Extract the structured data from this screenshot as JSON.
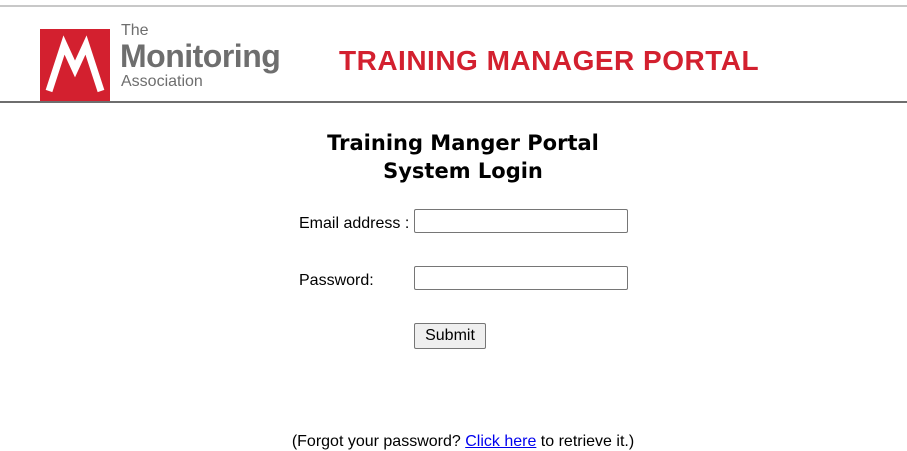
{
  "header": {
    "logo": {
      "line1": "The",
      "line2": "Monitoring",
      "line3": "Association"
    },
    "portal_title": "TRAINING MANAGER PORTAL",
    "brand_color": "#d3202f"
  },
  "login": {
    "heading_line1": "Training Manger Portal",
    "heading_line2": "System Login",
    "email_label": "Email address :",
    "email_value": "",
    "password_label": "Password:",
    "password_value": "",
    "submit_label": "Submit"
  },
  "forgot": {
    "prefix": "(Forgot your password? ",
    "link_text": "Click here",
    "suffix": " to retrieve it.)"
  }
}
